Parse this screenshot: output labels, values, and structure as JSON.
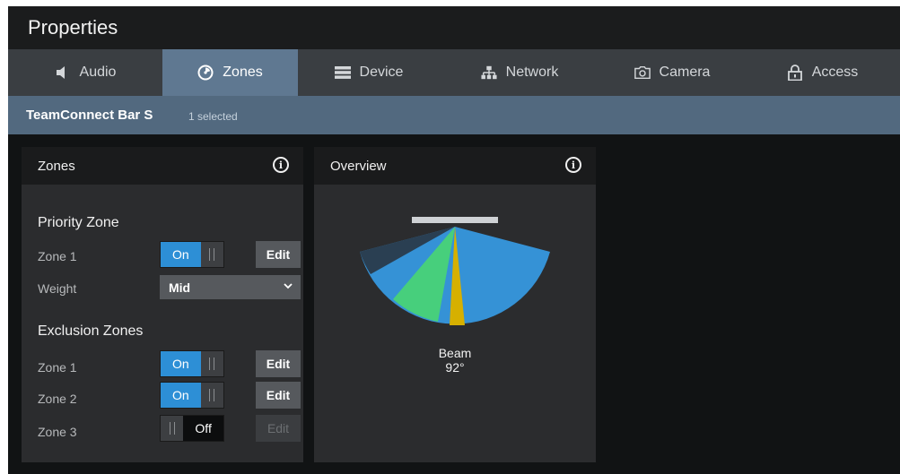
{
  "window": {
    "title": "Properties"
  },
  "tabs": [
    {
      "label": "Audio",
      "icon": "speaker-icon"
    },
    {
      "label": "Zones",
      "icon": "zones-icon",
      "active": true
    },
    {
      "label": "Device",
      "icon": "device-icon"
    },
    {
      "label": "Network",
      "icon": "network-icon"
    },
    {
      "label": "Camera",
      "icon": "camera-icon"
    },
    {
      "label": "Access",
      "icon": "lock-icon"
    }
  ],
  "device": {
    "name": "TeamConnect Bar S",
    "selection": "1 selected"
  },
  "zones_panel": {
    "title": "Zones",
    "priority": {
      "heading": "Priority Zone",
      "zone_label": "Zone 1",
      "zone_state": "On",
      "edit_label": "Edit",
      "weight_label": "Weight",
      "weight_value": "Mid"
    },
    "exclusion": {
      "heading": "Exclusion Zones",
      "zones": [
        {
          "label": "Zone 1",
          "state": "On",
          "on": true,
          "edit_label": "Edit",
          "edit_enabled": true
        },
        {
          "label": "Zone 2",
          "state": "On",
          "on": true,
          "edit_label": "Edit",
          "edit_enabled": true
        },
        {
          "label": "Zone 3",
          "state": "Off",
          "on": false,
          "edit_label": "Edit",
          "edit_enabled": false
        }
      ]
    }
  },
  "overview_panel": {
    "title": "Overview",
    "beam_label": "Beam",
    "beam_angle": "92°"
  },
  "colors": {
    "active_tab": "#5f7891",
    "toggle_on": "#2d8fd6",
    "coverage": "#3592d6",
    "priority_zone": "#47cf7c",
    "beam": "#d6b000",
    "exclusion_zone": "#2a3f52"
  }
}
